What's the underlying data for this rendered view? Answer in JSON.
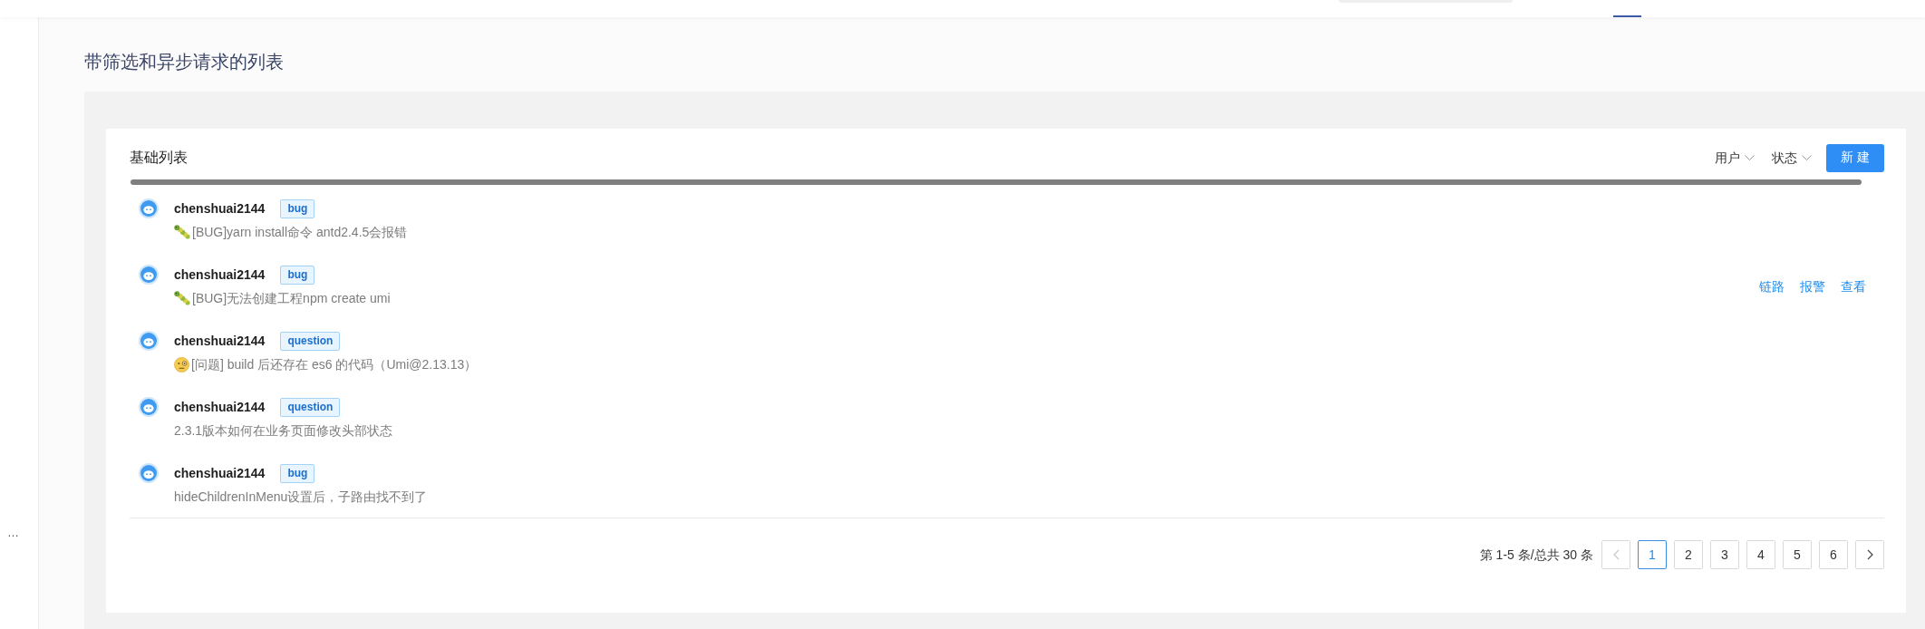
{
  "header": {
    "tabs": [
      {
        "selected": true
      }
    ]
  },
  "sidebar": {
    "items": [
      {
        "label": "…"
      }
    ]
  },
  "page": {
    "title": "带筛选和异步请求的列表"
  },
  "card": {
    "title": "基础列表",
    "filters": [
      {
        "label": "用户"
      },
      {
        "label": "状态"
      }
    ],
    "new_button": {
      "label": "新 建"
    }
  },
  "list": {
    "items": [
      {
        "author": "chenshuai2144",
        "tag": "bug",
        "description": {
          "kind": "bug-report",
          "text": "[BUG]yarn install命令 antd2.4.5会报错"
        }
      },
      {
        "author": "chenshuai2144",
        "tag": "bug",
        "description": {
          "kind": "bug-report",
          "text": "[BUG]无法创建工程npm create umi"
        },
        "actions": [
          {
            "label": "链路"
          },
          {
            "label": "报警"
          },
          {
            "label": "查看"
          }
        ]
      },
      {
        "author": "chenshuai2144",
        "tag": "question",
        "description": {
          "kind": "question",
          "text": "[问题] build 后还存在 es6 的代码（Umi@2.13.13）"
        }
      },
      {
        "author": "chenshuai2144",
        "tag": "question",
        "description": {
          "kind": "plain",
          "text": "2.3.1版本如何在业务页面修改头部状态"
        }
      },
      {
        "author": "chenshuai2144",
        "tag": "bug",
        "description": {
          "kind": "plain",
          "text": "hideChildrenInMenu设置后，子路由找不到了"
        }
      }
    ]
  },
  "pagination": {
    "summary": "第 1-5 条/总共 30 条",
    "prev": {
      "disabled": true
    },
    "pages": [
      {
        "label": "1",
        "selected": true
      },
      {
        "label": "2",
        "selected": false
      },
      {
        "label": "3",
        "selected": false
      },
      {
        "label": "4",
        "selected": false
      },
      {
        "label": "5",
        "selected": false
      },
      {
        "label": "6",
        "selected": false
      }
    ],
    "next": {
      "disabled": false
    }
  }
}
